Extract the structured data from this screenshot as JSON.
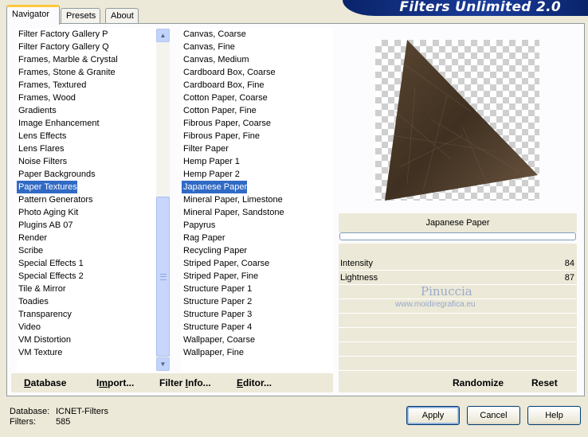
{
  "tabs": [
    "Navigator",
    "Presets",
    "About"
  ],
  "app_title": "Filters Unlimited 2.0",
  "categories": [
    "Filter Factory Gallery P",
    "Filter Factory Gallery Q",
    "Frames, Marble & Crystal",
    "Frames, Stone & Granite",
    "Frames, Textured",
    "Frames, Wood",
    "Gradients",
    "Image Enhancement",
    "Lens Effects",
    "Lens Flares",
    "Noise Filters",
    "Paper Backgrounds",
    "Paper Textures",
    "Pattern Generators",
    "Photo Aging Kit",
    "Plugins AB 07",
    "Render",
    "Scribe",
    "Special Effects 1",
    "Special Effects 2",
    "Tile & Mirror",
    "Toadies",
    "Transparency",
    "Video",
    "VM Distortion",
    "VM Texture"
  ],
  "selected_category": "Paper Textures",
  "filters": [
    "Canvas, Coarse",
    "Canvas, Fine",
    "Canvas, Medium",
    "Cardboard Box, Coarse",
    "Cardboard Box, Fine",
    "Cotton Paper, Coarse",
    "Cotton Paper, Fine",
    "Fibrous Paper, Coarse",
    "Fibrous Paper, Fine",
    "Filter Paper",
    "Hemp Paper 1",
    "Hemp Paper 2",
    "Japanese Paper",
    "Mineral Paper, Limestone",
    "Mineral Paper, Sandstone",
    "Papyrus",
    "Rag Paper",
    "Recycling Paper",
    "Striped Paper, Coarse",
    "Striped Paper, Fine",
    "Structure Paper 1",
    "Structure Paper 2",
    "Structure Paper 3",
    "Structure Paper 4",
    "Wallpaper, Coarse",
    "Wallpaper, Fine"
  ],
  "selected_filter": "Japanese Paper",
  "preview": {
    "filter_name": "Japanese Paper"
  },
  "params": [
    {
      "label": "Intensity",
      "value": "84"
    },
    {
      "label": "Lightness",
      "value": "87"
    }
  ],
  "watermark": {
    "name": "Pinuccia",
    "site": "www.moidiregrafica.eu"
  },
  "toolbar": {
    "database": {
      "u": "D",
      "rest": "atabase"
    },
    "import": {
      "pre": "I",
      "u": "m",
      "rest": "port..."
    },
    "filter_info": {
      "pre": "Filter ",
      "u": "I",
      "rest": "nfo..."
    },
    "editor": {
      "u": "E",
      "rest": "ditor..."
    },
    "randomize": "Randomize",
    "reset": "Reset"
  },
  "status": {
    "database_label": "Database:",
    "database_value": "ICNET-Filters",
    "filters_label": "Filters:",
    "filters_value": "585"
  },
  "buttons": {
    "apply": "Apply",
    "cancel": "Cancel",
    "help": "Help"
  },
  "colors": {
    "selection": "#316ac5",
    "title_bar": "#0a246a",
    "texture": "#4a3a2a"
  }
}
